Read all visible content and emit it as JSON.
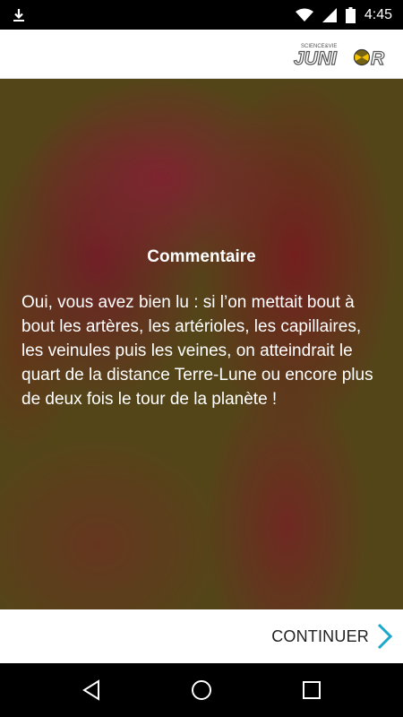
{
  "status_bar": {
    "time": "4:45",
    "icons": [
      "download-icon",
      "wifi-icon",
      "cell-signal-icon",
      "battery-icon"
    ]
  },
  "header": {
    "logo_text": "JUNIOR",
    "logo_subtext": "SCIENCE&VIE"
  },
  "content": {
    "title": "Commentaire",
    "body": "Oui, vous avez bien lu : si l’on mettait bout à bout les artères, les artérioles, les capillaires, les veinules puis les veines, on atteindrait le quart de la distance Terre-Lune ou encore plus de deux fois le tour de la planète !"
  },
  "footer": {
    "continue_label": "CONTINUER",
    "accent_color": "#1aa7c9"
  },
  "nav_bar": {
    "icons": [
      "back-icon",
      "home-icon",
      "recents-icon"
    ]
  }
}
